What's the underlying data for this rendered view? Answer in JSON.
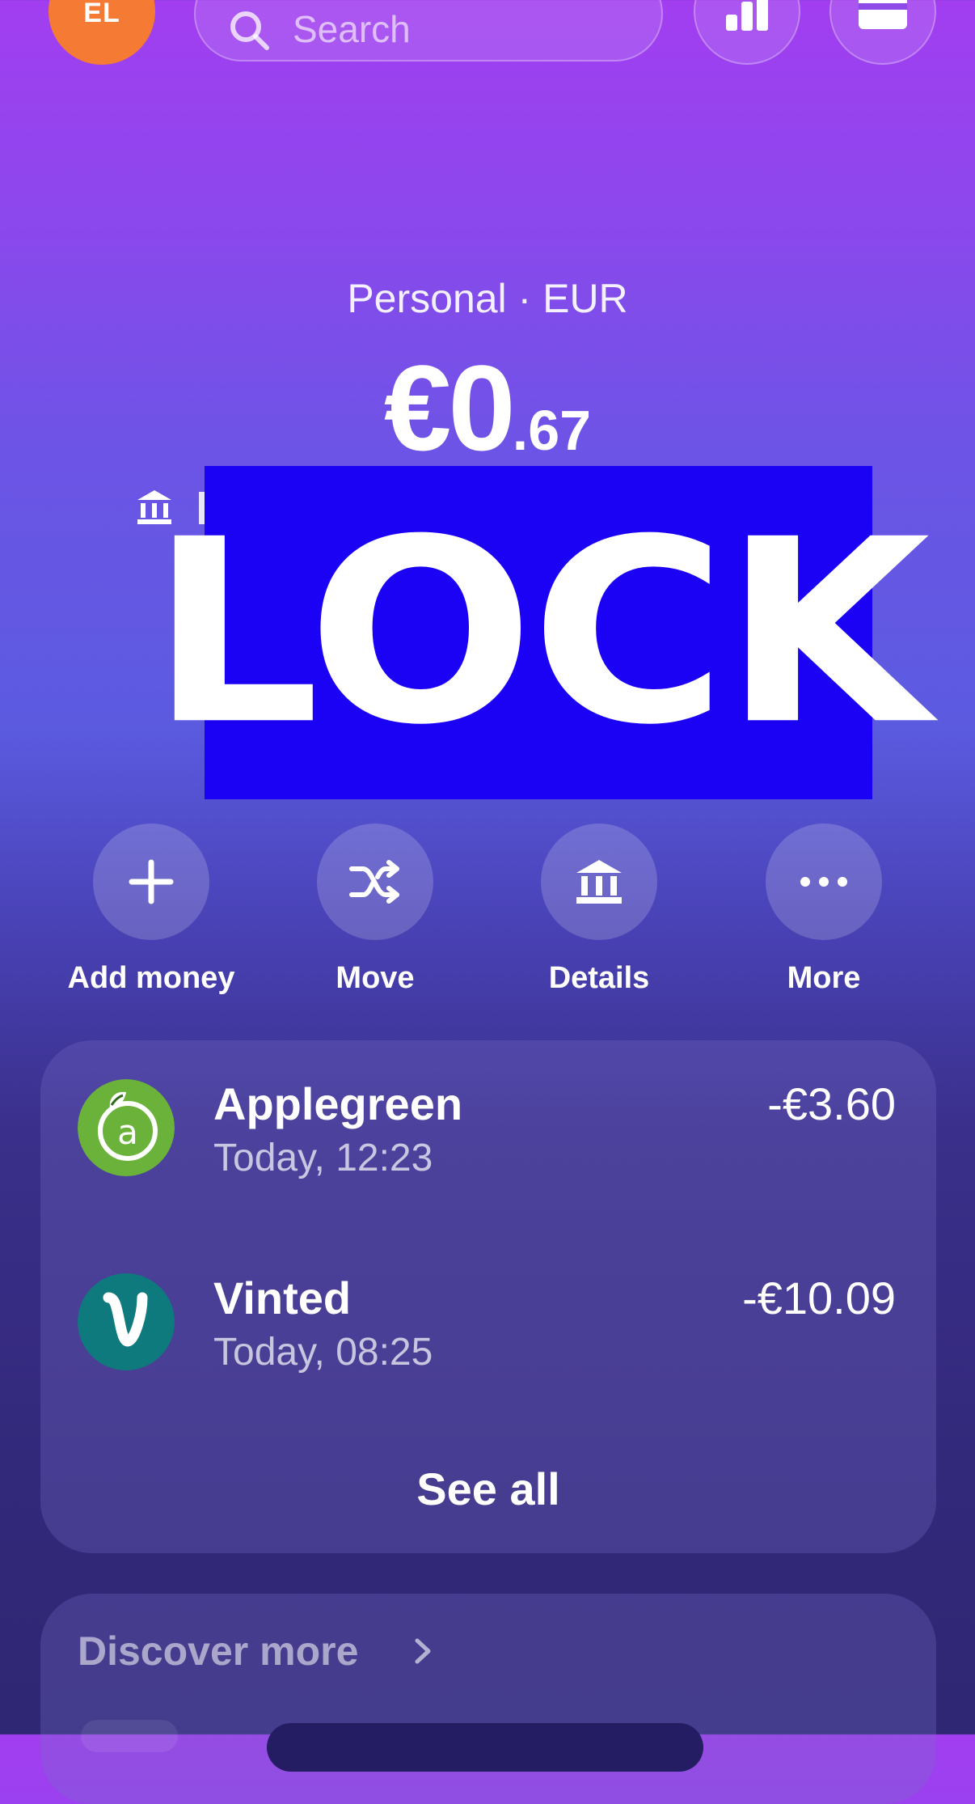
{
  "header": {
    "avatar_initials": "EL",
    "search": {
      "placeholder": "Search"
    },
    "buttons": [
      {
        "name": "analytics",
        "icon": "bar-chart-icon"
      },
      {
        "name": "cards",
        "icon": "card-icon"
      }
    ]
  },
  "account": {
    "label": "Personal · EUR",
    "balance_main": "€0",
    "balance_cents": ".67"
  },
  "overlay": {
    "text": "LOCK",
    "color": "#1c02f4"
  },
  "actions": [
    {
      "label": "Add money",
      "icon": "plus-icon"
    },
    {
      "label": "Move",
      "icon": "shuffle-icon"
    },
    {
      "label": "Details",
      "icon": "bank-icon"
    },
    {
      "label": "More",
      "icon": "more-dots-icon"
    }
  ],
  "transactions": {
    "items": [
      {
        "merchant": "Applegreen",
        "time": "Today, 12:23",
        "amount": "-€3.60",
        "logo": "applegreen-logo",
        "logo_color": "#6bb23a"
      },
      {
        "merchant": "Vinted",
        "time": "Today, 08:25",
        "amount": "-€10.09",
        "logo": "vinted-logo",
        "logo_color": "#0f7a7d"
      }
    ],
    "see_all_label": "See all"
  },
  "discover": {
    "title": "Discover more"
  },
  "colors": {
    "avatar": "#f57a34",
    "gradient_top": "#a23ef0",
    "gradient_bottom": "#2f2773"
  }
}
